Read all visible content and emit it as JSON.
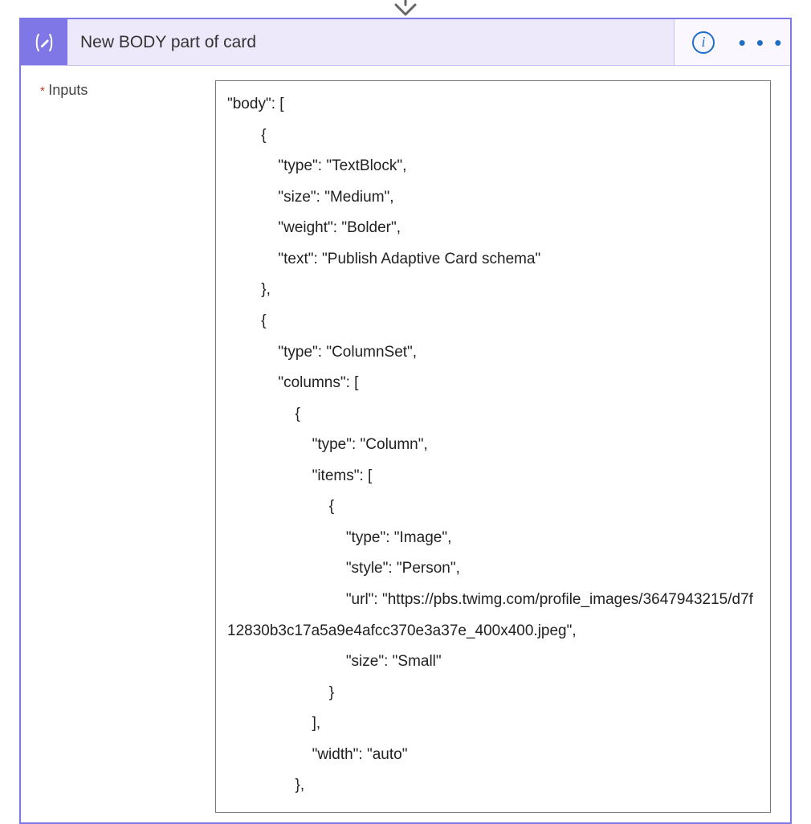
{
  "arrow": {
    "visible": true
  },
  "header": {
    "title": "New BODY part of card",
    "info_label": "i",
    "more_label": "• • •"
  },
  "form": {
    "label_required_marker": "*",
    "label": "Inputs",
    "value": "\"body\": [\n        {\n            \"type\": \"TextBlock\",\n            \"size\": \"Medium\",\n            \"weight\": \"Bolder\",\n            \"text\": \"Publish Adaptive Card schema\"\n        },\n        {\n            \"type\": \"ColumnSet\",\n            \"columns\": [\n                {\n                    \"type\": \"Column\",\n                    \"items\": [\n                        {\n                            \"type\": \"Image\",\n                            \"style\": \"Person\",\n                            \"url\": \"https://pbs.twimg.com/profile_images/3647943215/d7f12830b3c17a5a9e4afcc370e3a37e_400x400.jpeg\",\n                            \"size\": \"Small\"\n                        }\n                    ],\n                    \"width\": \"auto\"\n                },"
  }
}
